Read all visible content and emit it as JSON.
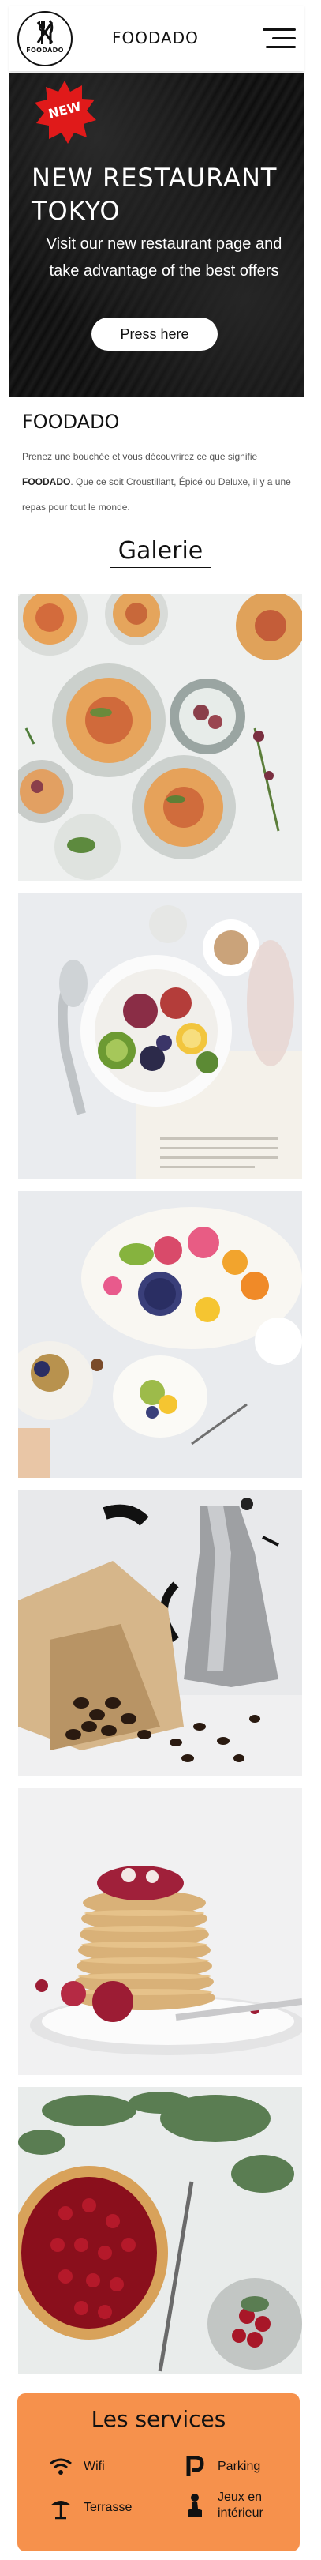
{
  "header": {
    "logo_text": "FOODADO",
    "title": "FOODADO",
    "menu_icon": "hamburger-menu-icon"
  },
  "hero": {
    "badge": "NEW",
    "badge_color": "#e01a1a",
    "title": "NEW RESTAURANT TOKYO",
    "subtitle": "Visit our new restaurant page and take advantage of the best offers",
    "button_label": "Press here"
  },
  "intro": {
    "title": "FOODADO",
    "text_before": "Prenez une bouchée et vous découvrirez ce que signifie ",
    "text_brand": "FOODADO",
    "text_after": ". Que ce soit Croustillant, Épicé ou Deluxe, il y a une repas pour tout le monde."
  },
  "gallery": {
    "title": "Galerie",
    "photos": [
      "tartlets-platter",
      "fruit-bowl",
      "fruit-platter",
      "coffee-beans-moka",
      "pancake-stack",
      "cranberry-tart"
    ]
  },
  "services": {
    "title": "Les services",
    "background": "#f6914c",
    "items": [
      {
        "icon": "wifi-icon",
        "label": "Wifi"
      },
      {
        "icon": "parking-icon",
        "label": "Parking"
      },
      {
        "icon": "terrace-umbrella-icon",
        "label": "Terrasse"
      },
      {
        "icon": "games-icon",
        "label": "Jeux en intérieur"
      }
    ]
  }
}
